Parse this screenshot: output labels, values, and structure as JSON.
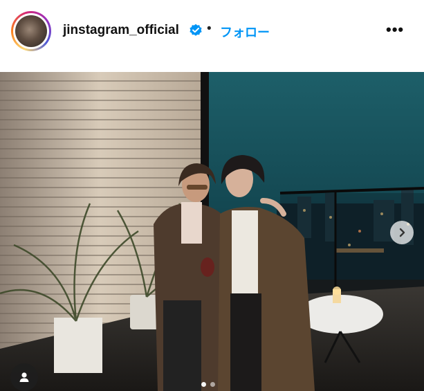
{
  "header": {
    "username": "jinstagram_official",
    "separator": "•",
    "follow_label": "フォロー",
    "more_label": "•••",
    "verified_icon": "verified-badge-icon",
    "accent_color": "#0095f6"
  },
  "post": {
    "image_alt": "",
    "carousel": {
      "current": 1,
      "total": 2
    },
    "next_icon": "chevron-right-icon",
    "tag_icon": "user-tag-icon"
  }
}
